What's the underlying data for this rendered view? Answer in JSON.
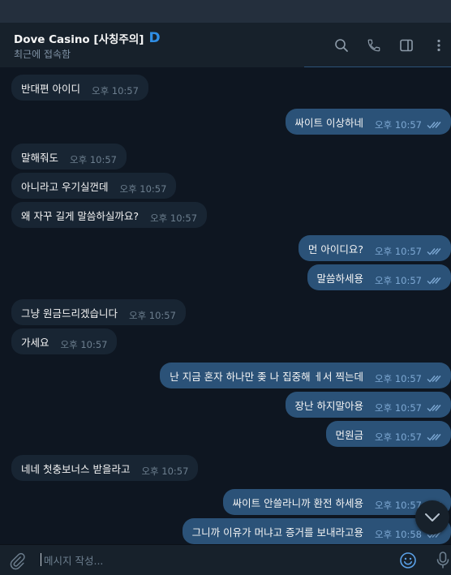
{
  "header": {
    "title": "Dove Casino [사칭주의]",
    "badge": "D",
    "status": "최근에 접속함"
  },
  "composer": {
    "placeholder": "메시지 작성..."
  },
  "messages": [
    {
      "dir": "in",
      "text": "반대편 아이디",
      "time": "오후 10:57"
    },
    {
      "dir": "out",
      "text": "싸이트 이상하네",
      "time": "오후 10:57"
    },
    {
      "dir": "in",
      "text": "말해줘도",
      "time": "오후 10:57"
    },
    {
      "dir": "in",
      "text": "아니라고 우기실껀데",
      "time": "오후 10:57"
    },
    {
      "dir": "in",
      "text": "왜 자꾸 길게 말씀하실까요?",
      "time": "오후 10:57"
    },
    {
      "dir": "out",
      "text": "먼 아이디요?",
      "time": "오후 10:57"
    },
    {
      "dir": "out",
      "text": "말씀하세용",
      "time": "오후 10:57"
    },
    {
      "dir": "in",
      "text": "그냥 원금드리겠습니다",
      "time": "오후 10:57"
    },
    {
      "dir": "in",
      "text": "가세요",
      "time": "오후 10:57"
    },
    {
      "dir": "out",
      "text": "난 지금 혼자 하나만 좆 나  집중해 ㅔ서 찍는데",
      "time": "오후 10:57"
    },
    {
      "dir": "out",
      "text": "장난 하지말아용",
      "time": "오후 10:57"
    },
    {
      "dir": "out",
      "text": "먼원금",
      "time": "오후 10:57"
    },
    {
      "dir": "in",
      "text": "네네 첫충보너스 받을라고",
      "time": "오후 10:57"
    },
    {
      "dir": "out",
      "text": "싸이트  안쓸라니까 환전 하세용",
      "time": "오후 10:57"
    },
    {
      "dir": "out",
      "text": "그니까 이유가 머냐고 증거를 보내라고용",
      "time": "오후 10:58"
    }
  ],
  "colors": {
    "background": "#0e1621",
    "incoming_bubble": "#182533",
    "outgoing_bubble": "#2b5278",
    "accent": "#2f8ee5"
  },
  "icons": [
    "search-icon",
    "phone-icon",
    "sidebar-panel-icon",
    "more-vertical-icon",
    "paperclip-icon",
    "emoji-icon",
    "microphone-icon",
    "chevron-down-icon",
    "double-check-icon"
  ]
}
